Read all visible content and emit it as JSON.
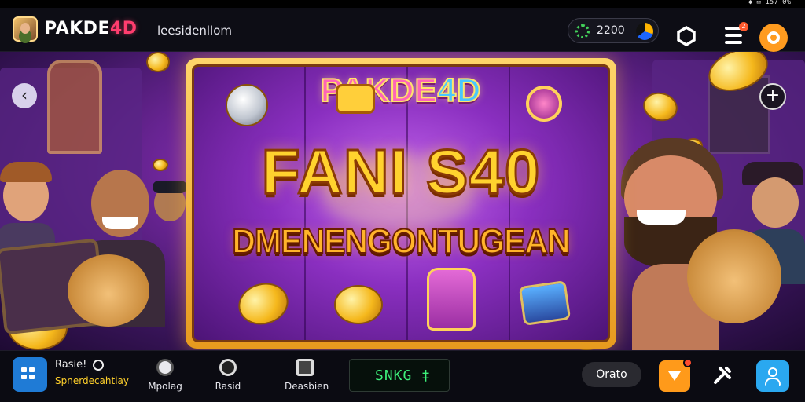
{
  "statusbar": {
    "system": "◆ ✉ 157 0%"
  },
  "header": {
    "brand_main": "PAKDE",
    "brand_accent": "4D",
    "greeting": "leesidenllom",
    "wallet_amount": "2200",
    "menu_badge": "2"
  },
  "banner": {
    "logo_main": "PAKDE",
    "logo_accent": "4D",
    "title": "FANI S40",
    "subtitle": "DMENENGONTUGEAN"
  },
  "scene_icons": [
    "back-arrow-icon",
    "plus-icon",
    "gold-coin-icon",
    "slot-symbol-icon"
  ],
  "bottom_nav": {
    "search_title": "Rasie!",
    "search_subtitle": "Spnerdecahtiay",
    "tabs": [
      {
        "label": "Mpolag",
        "icon": "chip-icon"
      },
      {
        "label": "Rasid",
        "icon": "search-icon"
      },
      {
        "label": "Deasbien",
        "icon": "bag-icon"
      }
    ],
    "status_value": "SNKG ‡",
    "pill_label": "Orato"
  },
  "colors": {
    "accent_orange": "#ff9b1f",
    "accent_blue": "#1f7bd6",
    "status_green": "#3df07a",
    "brand_pink": "#ff3d6e"
  }
}
